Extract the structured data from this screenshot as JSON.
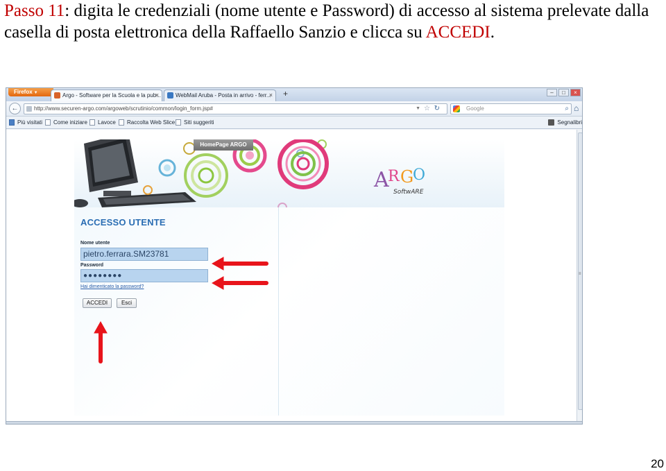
{
  "caption": {
    "step": "Passo 11",
    "text_part1": ": digita le credenziali (nome utente e Password) di accesso al sistema prelevate dalla casella di posta elettronica della Raffaello Sanzio e clicca su ",
    "highlight": "ACCEDI",
    "text_end": "."
  },
  "page_number": "20",
  "browser": {
    "firefox_button": "Firefox",
    "tabs": [
      {
        "label": "Argo - Software per la Scuola e la pub...",
        "close": "×"
      },
      {
        "label": "WebMail Aruba - Posta in arrivo - ferr...",
        "close": "×"
      }
    ],
    "new_tab": "+",
    "window_controls": [
      "–",
      "□",
      "×"
    ],
    "back": "←",
    "url": "http://www.securen-argo.com/argoweb/scrutinio/common/login_form.jsp#",
    "search_placeholder": "Google",
    "bookmarks": [
      "Più visitati",
      "Come iniziare",
      "Lavoce",
      "Raccolta Web Slice",
      "Siti suggeriti"
    ],
    "bookmarks_right": "Segnalibri"
  },
  "argo": {
    "homepage_tab": "HomePage ARGO",
    "login_title": "ACCESSO UTENTE",
    "username_label": "Nome utente",
    "username_value": "pietro.ferrara.SM23781",
    "password_label": "Password",
    "password_value": "●●●●●●●●",
    "forgot_link": "Hai dimenticato la password?",
    "login_button": "ACCEDI",
    "exit_button": "Esci"
  },
  "colors": {
    "caption_highlight": "#c00000",
    "arrow": "#e8141b",
    "login_title": "#2a6db3",
    "field_bg": "#b8d4ef"
  }
}
